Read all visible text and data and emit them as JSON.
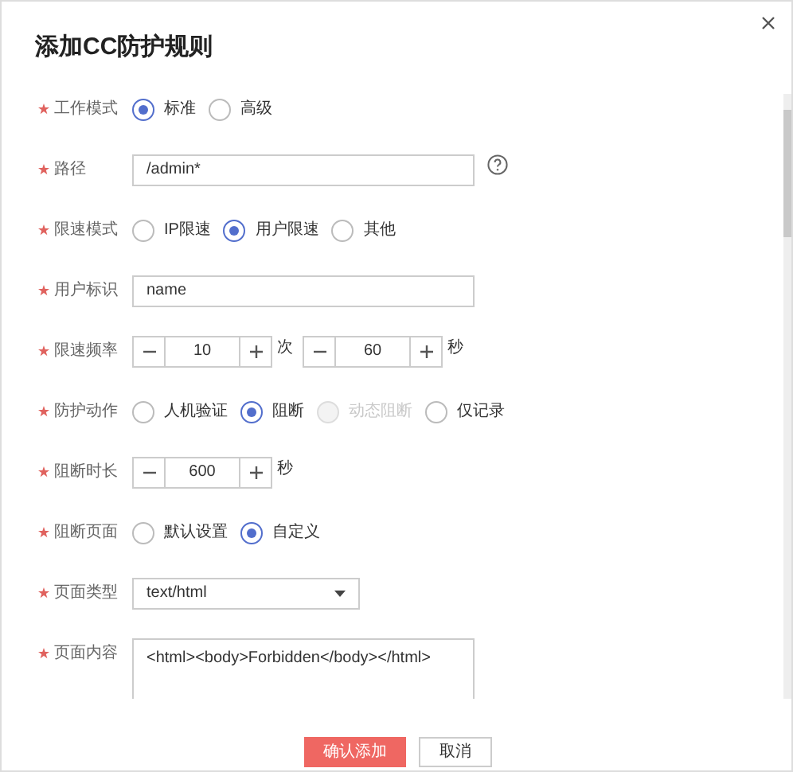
{
  "dialog": {
    "title": "添加CC防护规则"
  },
  "fields": [
    {
      "kind": "radio",
      "required": true,
      "label": "工作模式",
      "options": [
        {
          "label": "标准",
          "selected": true,
          "disabled": false
        },
        {
          "label": "高级",
          "selected": false,
          "disabled": false
        }
      ]
    },
    {
      "kind": "text",
      "required": true,
      "label": "路径",
      "value": "/admin*",
      "help": true
    },
    {
      "kind": "radio",
      "required": true,
      "label": "限速模式",
      "options": [
        {
          "label": "IP限速",
          "selected": false,
          "disabled": false
        },
        {
          "label": "用户限速",
          "selected": true,
          "disabled": false
        },
        {
          "label": "其他",
          "selected": false,
          "disabled": false
        }
      ]
    },
    {
      "kind": "text",
      "required": true,
      "label": "用户标识",
      "value": "name",
      "help": false
    },
    {
      "kind": "stepper",
      "required": true,
      "label": "限速频率",
      "steppers": [
        {
          "value": "10",
          "unit": "次"
        },
        {
          "value": "60",
          "unit": "秒"
        }
      ]
    },
    {
      "kind": "radio",
      "required": true,
      "label": "防护动作",
      "options": [
        {
          "label": "人机验证",
          "selected": false,
          "disabled": false
        },
        {
          "label": "阻断",
          "selected": true,
          "disabled": false
        },
        {
          "label": "动态阻断",
          "selected": false,
          "disabled": true
        },
        {
          "label": "仅记录",
          "selected": false,
          "disabled": false
        }
      ]
    },
    {
      "kind": "stepper",
      "required": true,
      "label": "阻断时长",
      "steppers": [
        {
          "value": "600",
          "unit": "秒"
        }
      ]
    },
    {
      "kind": "radio",
      "required": true,
      "label": "阻断页面",
      "options": [
        {
          "label": "默认设置",
          "selected": false,
          "disabled": false
        },
        {
          "label": "自定义",
          "selected": true,
          "disabled": false
        }
      ]
    },
    {
      "kind": "select",
      "required": true,
      "label": "页面类型",
      "value": "text/html"
    },
    {
      "kind": "textarea",
      "required": true,
      "label": "页面内容",
      "value": "<html><body>Forbidden</body></html>"
    }
  ],
  "buttons": [
    {
      "label": "确认添加",
      "primary": true
    },
    {
      "label": "取消",
      "primary": false
    }
  ]
}
